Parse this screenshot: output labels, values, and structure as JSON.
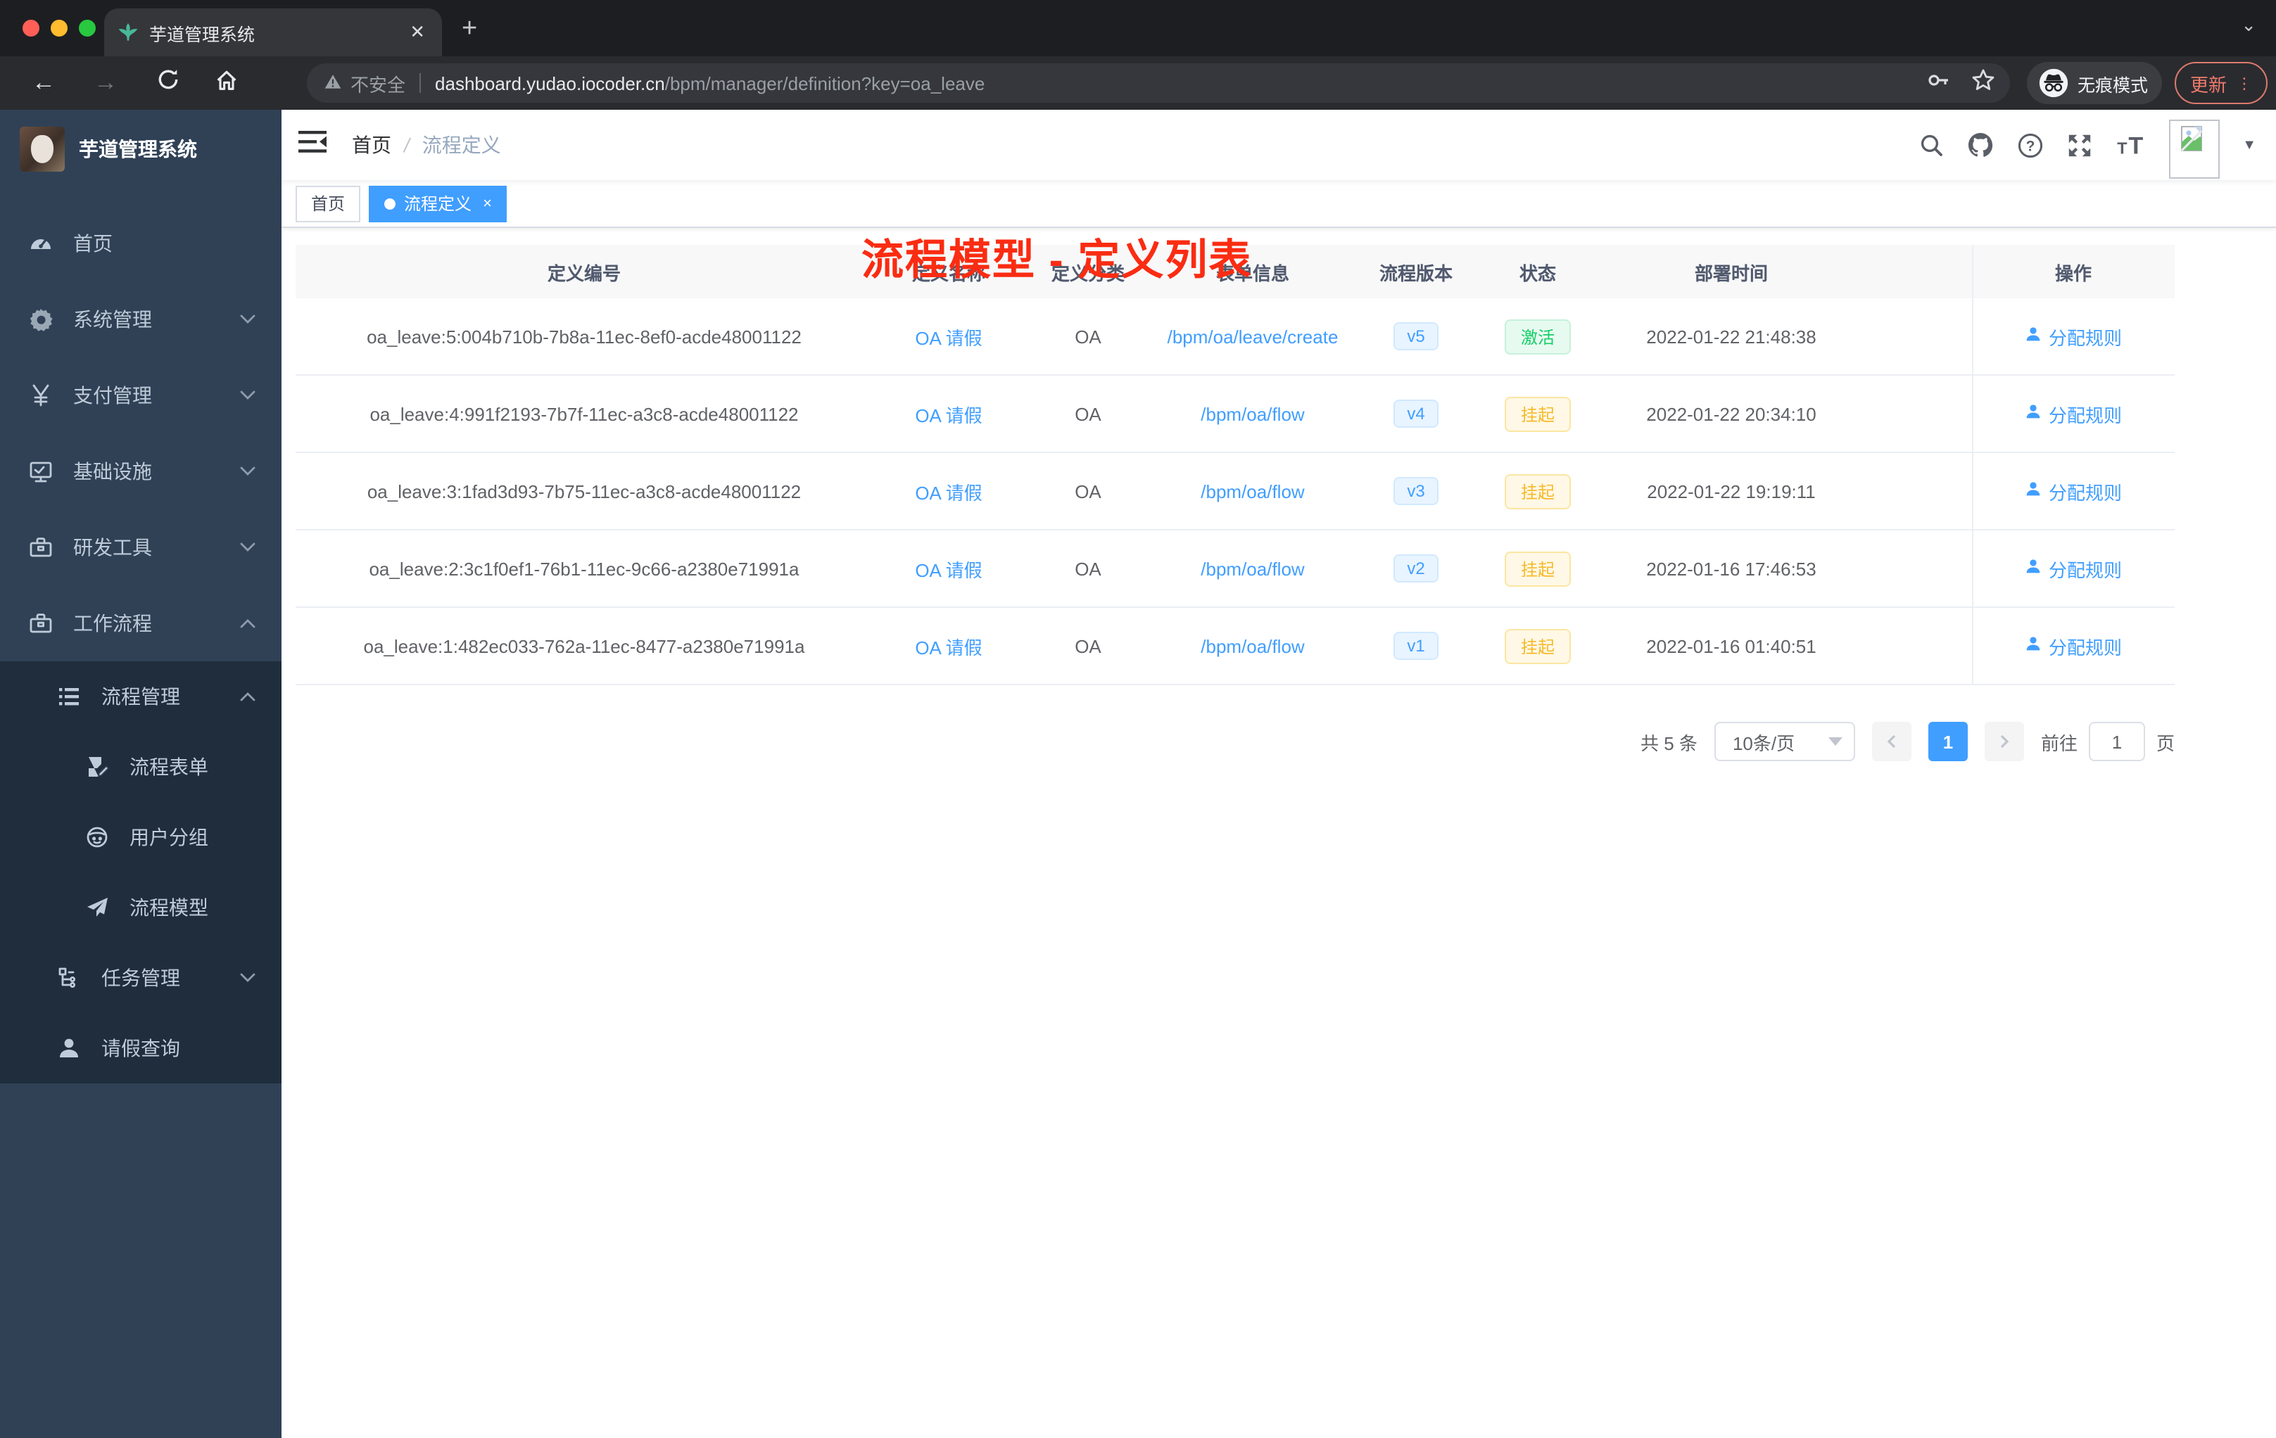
{
  "browser": {
    "tab_title": "芋道管理系统",
    "new_tab_label": "+",
    "security_label": "不安全",
    "url_domain": "dashboard.yudao.iocoder.cn",
    "url_path": "/bpm/manager/definition?key=oa_leave",
    "incognito_label": "无痕模式",
    "update_label": "更新"
  },
  "sidebar": {
    "logo_title": "芋道管理系统",
    "menu": [
      {
        "label": "首页",
        "icon": "dashboard-icon",
        "level": 1,
        "arrow": "",
        "dark": false
      },
      {
        "label": "系统管理",
        "icon": "gear-icon",
        "level": 1,
        "arrow": "down",
        "dark": false
      },
      {
        "label": "支付管理",
        "icon": "yen-icon",
        "level": 1,
        "arrow": "down",
        "dark": false
      },
      {
        "label": "基础设施",
        "icon": "monitor-icon",
        "level": 1,
        "arrow": "down",
        "dark": false
      },
      {
        "label": "研发工具",
        "icon": "toolbox-icon",
        "level": 1,
        "arrow": "down",
        "dark": false
      },
      {
        "label": "工作流程",
        "icon": "briefcase-icon",
        "level": 1,
        "arrow": "up",
        "dark": false
      },
      {
        "label": "流程管理",
        "icon": "list-icon",
        "level": 2,
        "arrow": "up",
        "dark": true
      },
      {
        "label": "流程表单",
        "icon": "form-edit-icon",
        "level": 3,
        "arrow": "",
        "dark": true
      },
      {
        "label": "用户分组",
        "icon": "robot-icon",
        "level": 3,
        "arrow": "",
        "dark": true
      },
      {
        "label": "流程模型",
        "icon": "paper-plane-icon",
        "level": 3,
        "arrow": "",
        "dark": true
      },
      {
        "label": "任务管理",
        "icon": "tree-icon",
        "level": 2,
        "arrow": "down",
        "dark": true
      },
      {
        "label": "请假查询",
        "icon": "user-icon",
        "level": 2,
        "arrow": "",
        "dark": true
      }
    ]
  },
  "navbar": {
    "breadcrumb": [
      "首页",
      "流程定义"
    ],
    "breadcrumb_separator": "/",
    "overlay_title": "流程模型 - 定义列表",
    "right_icons": [
      "search-icon",
      "github-icon",
      "help-icon",
      "fullscreen-icon",
      "font-size-icon",
      "avatar",
      "caret-down-icon"
    ]
  },
  "tags": [
    {
      "label": "首页",
      "active": false
    },
    {
      "label": "流程定义",
      "active": true,
      "close": "×"
    }
  ],
  "table": {
    "columns": [
      "定义编号",
      "定义名称",
      "定义分类",
      "表单信息",
      "流程版本",
      "状态",
      "部署时间",
      "操作"
    ],
    "action_label": "分配规则",
    "rows": [
      {
        "id": "oa_leave:5:004b710b-7b8a-11ec-8ef0-acde48001122",
        "name": "OA 请假",
        "category": "OA",
        "form": "/bpm/oa/leave/create",
        "version": "v5",
        "status": {
          "label": "激活",
          "type": "success"
        },
        "deploy_time": "2022-01-22 21:48:38"
      },
      {
        "id": "oa_leave:4:991f2193-7b7f-11ec-a3c8-acde48001122",
        "name": "OA 请假",
        "category": "OA",
        "form": "/bpm/oa/flow",
        "version": "v4",
        "status": {
          "label": "挂起",
          "type": "warning"
        },
        "deploy_time": "2022-01-22 20:34:10"
      },
      {
        "id": "oa_leave:3:1fad3d93-7b75-11ec-a3c8-acde48001122",
        "name": "OA 请假",
        "category": "OA",
        "form": "/bpm/oa/flow",
        "version": "v3",
        "status": {
          "label": "挂起",
          "type": "warning"
        },
        "deploy_time": "2022-01-22 19:19:11"
      },
      {
        "id": "oa_leave:2:3c1f0ef1-76b1-11ec-9c66-a2380e71991a",
        "name": "OA 请假",
        "category": "OA",
        "form": "/bpm/oa/flow",
        "version": "v2",
        "status": {
          "label": "挂起",
          "type": "warning"
        },
        "deploy_time": "2022-01-16 17:46:53"
      },
      {
        "id": "oa_leave:1:482ec033-762a-11ec-8477-a2380e71991a",
        "name": "OA 请假",
        "category": "OA",
        "form": "/bpm/oa/flow",
        "version": "v1",
        "status": {
          "label": "挂起",
          "type": "warning"
        },
        "deploy_time": "2022-01-16 01:40:51"
      }
    ]
  },
  "pagination": {
    "total": "共 5 条",
    "page_size": "10条/页",
    "current_page": "1",
    "goto_label": "前往",
    "goto_value": "1",
    "page_unit": "页"
  },
  "colors": {
    "accent": "#409eff",
    "annotation": "#fa2c12",
    "status_active": "#13ce66",
    "status_suspended": "#f7ba2a",
    "sidebar_bg": "#304156",
    "submenu_bg": "#1f2d3d"
  }
}
